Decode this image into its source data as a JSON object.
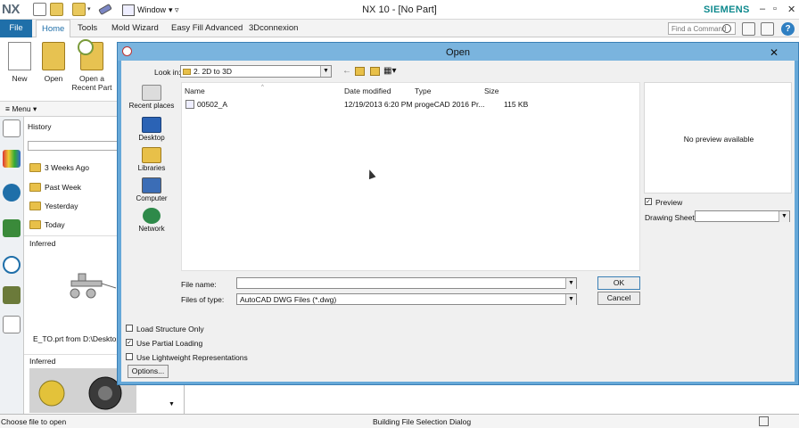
{
  "titlebar": {
    "logo": "NX",
    "window_menu": "Window",
    "title": "NX 10 - [No Part]",
    "brand": "SIEMENS"
  },
  "tabs": [
    "File",
    "Home",
    "Tools",
    "Mold Wizard",
    "Easy Fill Advanced",
    "3Dconnexion"
  ],
  "find_command_placeholder": "Find a Command",
  "ribbon": {
    "new_label": "New",
    "open_label": "Open",
    "recent_label_1": "Open a",
    "recent_label_2": "Recent Part"
  },
  "menu_label": "Menu",
  "history": {
    "title": "History",
    "groups": [
      "3 Weeks Ago",
      "Past Week",
      "Yesterday",
      "Today"
    ],
    "inferred_1": "Inferred",
    "thumb_label": "E_TO.prt from D:\\Desktop\\",
    "inferred_2": "Inferred"
  },
  "dialog": {
    "title": "Open",
    "look_in_label": "Look in:",
    "look_in_value": "2. 2D to 3D",
    "places": [
      "Recent places",
      "Desktop",
      "Libraries",
      "Computer",
      "Network"
    ],
    "columns": [
      "Name",
      "Date modified",
      "Type",
      "Size"
    ],
    "files": [
      {
        "name": "00502_A",
        "date": "12/19/2013 6:20 PM",
        "type": "progeCAD 2016 Pr...",
        "size": "115 KB"
      }
    ],
    "no_preview": "No preview available",
    "preview_label": "Preview",
    "drawing_sheet_label": "Drawing Sheet",
    "file_name_label": "File name:",
    "file_name_value": "",
    "files_of_type_label": "Files of type:",
    "files_of_type_value": "AutoCAD DWG Files (*.dwg)",
    "ok_label": "OK",
    "cancel_label": "Cancel",
    "load_structure_label": "Load Structure Only",
    "partial_loading_label": "Use Partial Loading",
    "lightweight_label": "Use Lightweight Representations",
    "options_label": "Options..."
  },
  "status": {
    "left": "Choose file to open",
    "middle": "Building File Selection Dialog"
  }
}
